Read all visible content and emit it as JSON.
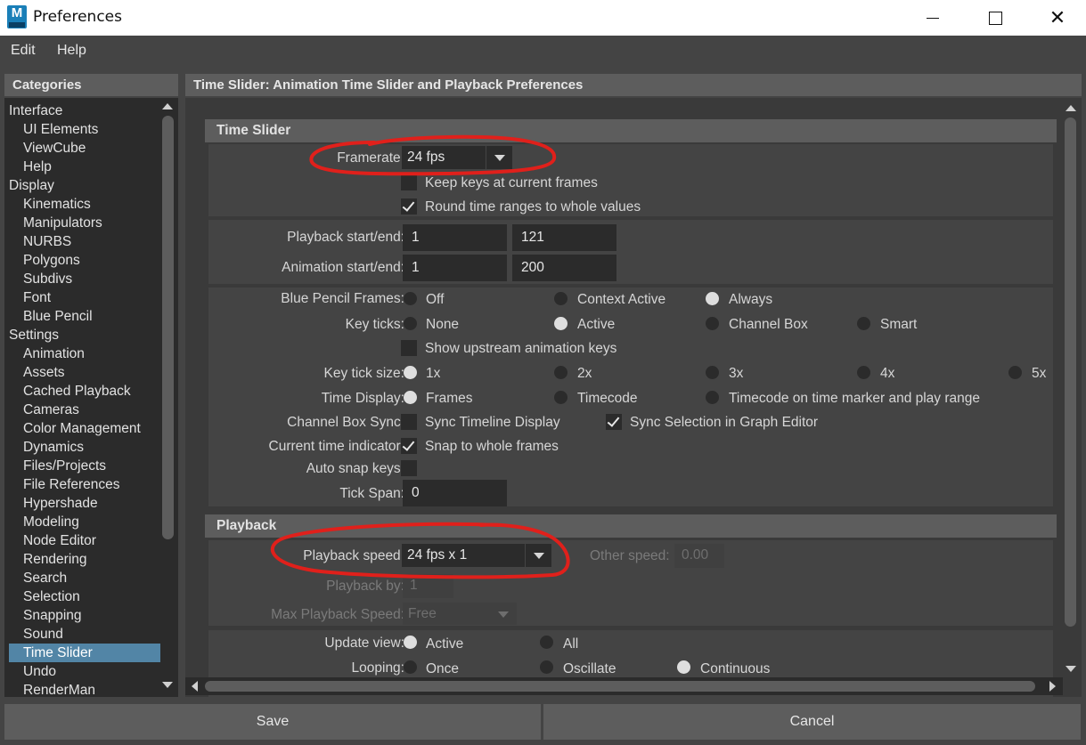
{
  "window": {
    "title": "Preferences",
    "app_icon_letter": "M",
    "minimize": "minimize",
    "maximize": "maximize",
    "close": "✕"
  },
  "menubar": {
    "items": [
      "Edit",
      "Help"
    ]
  },
  "categories": {
    "header": "Categories",
    "items": [
      {
        "label": "Interface",
        "level": 0
      },
      {
        "label": "UI Elements",
        "level": 1
      },
      {
        "label": "ViewCube",
        "level": 1
      },
      {
        "label": "Help",
        "level": 1
      },
      {
        "label": "Display",
        "level": 0
      },
      {
        "label": "Kinematics",
        "level": 1
      },
      {
        "label": "Manipulators",
        "level": 1
      },
      {
        "label": "NURBS",
        "level": 1
      },
      {
        "label": "Polygons",
        "level": 1
      },
      {
        "label": "Subdivs",
        "level": 1
      },
      {
        "label": "Font",
        "level": 1
      },
      {
        "label": "Blue Pencil",
        "level": 1
      },
      {
        "label": "Settings",
        "level": 0
      },
      {
        "label": "Animation",
        "level": 1
      },
      {
        "label": "Assets",
        "level": 1
      },
      {
        "label": "Cached Playback",
        "level": 1
      },
      {
        "label": "Cameras",
        "level": 1
      },
      {
        "label": "Color Management",
        "level": 1
      },
      {
        "label": "Dynamics",
        "level": 1
      },
      {
        "label": "Files/Projects",
        "level": 1
      },
      {
        "label": "File References",
        "level": 1
      },
      {
        "label": "Hypershade",
        "level": 1
      },
      {
        "label": "Modeling",
        "level": 1
      },
      {
        "label": "Node Editor",
        "level": 1
      },
      {
        "label": "Rendering",
        "level": 1
      },
      {
        "label": "Search",
        "level": 1
      },
      {
        "label": "Selection",
        "level": 1
      },
      {
        "label": "Snapping",
        "level": 1
      },
      {
        "label": "Sound",
        "level": 1
      },
      {
        "label": "Time Slider",
        "level": 1,
        "selected": true
      },
      {
        "label": "Undo",
        "level": 1
      },
      {
        "label": "RenderMan",
        "level": 1
      }
    ]
  },
  "main": {
    "header": "Time Slider: Animation Time Slider and Playback Preferences",
    "time_slider": {
      "title": "Time Slider",
      "framerate_label": "Framerate:",
      "framerate_value": "24 fps",
      "keep_keys": "Keep keys at current frames",
      "round_time": "Round time ranges to whole values",
      "playback_label": "Playback start/end:",
      "playback_start": "1",
      "playback_end": "121",
      "animation_label": "Animation start/end:",
      "animation_start": "1",
      "animation_end": "200",
      "blue_pencil_label": "Blue Pencil Frames:",
      "blue_pencil_opts": [
        "Off",
        "Context Active",
        "Always"
      ],
      "key_ticks_label": "Key ticks:",
      "key_ticks_opts": [
        "None",
        "Active",
        "Channel Box",
        "Smart"
      ],
      "show_upstream": "Show upstream animation keys",
      "key_tick_size_label": "Key tick size:",
      "key_tick_size_opts": [
        "1x",
        "2x",
        "3x",
        "4x",
        "5x"
      ],
      "time_display_label": "Time Display:",
      "time_display_opts": [
        "Frames",
        "Timecode",
        "Timecode on time marker and play range"
      ],
      "channel_box_sync_label": "Channel Box Sync:",
      "sync_timeline": "Sync Timeline Display",
      "sync_selection": "Sync Selection in Graph Editor",
      "current_time_label": "Current time indicator:",
      "snap_whole": "Snap to whole frames",
      "auto_snap_label": "Auto snap keys:",
      "tick_span_label": "Tick Span:",
      "tick_span_value": "0"
    },
    "playback": {
      "title": "Playback",
      "speed_label": "Playback speed:",
      "speed_value": "24 fps x 1",
      "other_speed_label": "Other speed:",
      "other_speed_value": "0.00",
      "playback_by_label": "Playback by:",
      "playback_by_value": "1",
      "max_speed_label": "Max Playback Speed:",
      "max_speed_value": "Free",
      "update_view_label": "Update view:",
      "update_view_opts": [
        "Active",
        "All"
      ],
      "looping_label": "Looping:",
      "looping_opts": [
        "Once",
        "Oscillate",
        "Continuous"
      ]
    }
  },
  "buttons": {
    "save": "Save",
    "cancel": "Cancel"
  },
  "colors": {
    "selection": "#5285a6",
    "annotation": "#e0201b",
    "panel": "#444444",
    "field": "#2b2b2b"
  }
}
